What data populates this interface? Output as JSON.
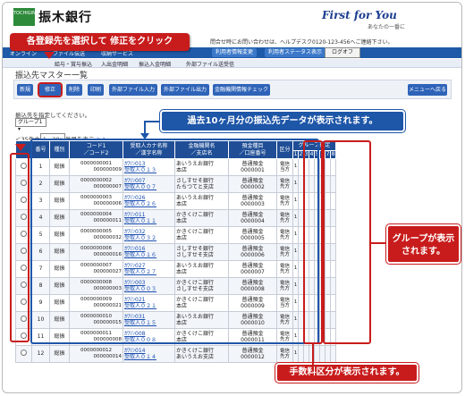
{
  "header": {
    "logo_text": "TOCHIGIN",
    "bank_name": "振木銀行",
    "slogan": "First for You",
    "tagline": "あなたの一番に",
    "contact": "問合せ時にお問い合わせは、ヘルプデスク0120-123-456へご連絡下さい。"
  },
  "nav": {
    "items": [
      "オンライン",
      "ファイル伝送",
      "収納サービス"
    ],
    "pills": [
      "利用者情報変更",
      "利用者ステータス表示"
    ],
    "logout": "ログオフ"
  },
  "sub_nav": [
    "給与・賞与振込",
    "入出金明細",
    "振込入金明細",
    "外部ファイル送受信"
  ],
  "page_title": "振込先マスター一覧",
  "toolbar": {
    "buttons": [
      "新規",
      "修正",
      "削除",
      "印刷",
      "外部ファイル入力",
      "外部ファイル出力",
      "金融機関情報チェック"
    ],
    "menu_back": "メニューへ戻る"
  },
  "instruction": "振込先を指定してください。",
  "group_select": "グループ1",
  "pager": {
    "prefix": "＜35件中",
    "select_value": "1〜20",
    "suffix": "件目を表示",
    "next": "＞＞"
  },
  "table": {
    "headers": {
      "num": "番号",
      "kind": "種別",
      "code": "コード1\n／コード2",
      "kana": "受取人カナ名称\n／漢字名称",
      "bank": "金融機関名\n／支店名",
      "account": "預金種目\n／口座番号",
      "fee": "区分",
      "group": "グループ指定",
      "group_cols": [
        "1",
        "2",
        "3",
        "4",
        "5",
        "6",
        "7",
        "8"
      ]
    },
    "rows": [
      {
        "num": "1",
        "kind": "総振",
        "code1": "0000000001",
        "code2": "000000009",
        "kana": "ｶﾜﾘﾝ013",
        "kanji": "受取人０１３",
        "bank": "あいうえお銀行",
        "branch": "本店",
        "acct_type": "普通預金",
        "acct_no": "0000001",
        "fee": "電信当方",
        "groups": [
          "1",
          "",
          "",
          "",
          "",
          "",
          "",
          ""
        ]
      },
      {
        "num": "2",
        "kind": "総振",
        "code1": "0000000002",
        "code2": "000000007",
        "kana": "ｶﾜﾘﾝ007",
        "kanji": "受取人００７",
        "bank": "さしすせそ銀行",
        "branch": "たちつてと支店",
        "acct_type": "普通預金",
        "acct_no": "0000002",
        "fee": "電信先方",
        "groups": [
          "1",
          "",
          "",
          "",
          "",
          "",
          "",
          ""
        ]
      },
      {
        "num": "3",
        "kind": "総振",
        "code1": "0000000003",
        "code2": "000000006",
        "kana": "ｶﾜﾘﾝ026",
        "kanji": "受取人０２６",
        "bank": "あいうえお銀行",
        "branch": "本店",
        "acct_type": "普通預金",
        "acct_no": "0000003",
        "fee": "電信先方",
        "groups": [
          "1",
          "",
          "",
          "",
          "",
          "",
          "",
          ""
        ]
      },
      {
        "num": "4",
        "kind": "総振",
        "code1": "0000000004",
        "code2": "000000011",
        "kana": "ｶﾜﾘﾝ011",
        "kanji": "受取人０１１",
        "bank": "かきくけこ銀行",
        "branch": "本店",
        "acct_type": "普通預金",
        "acct_no": "0000004",
        "fee": "電信先方",
        "groups": [
          "1",
          "",
          "",
          "",
          "",
          "",
          "",
          ""
        ]
      },
      {
        "num": "5",
        "kind": "総振",
        "code1": "0000000005",
        "code2": "000000032",
        "kana": "ｶﾜﾘﾝ032",
        "kanji": "受取人０３２",
        "bank": "かきくけこ銀行",
        "branch": "本店",
        "acct_type": "普通預金",
        "acct_no": "0000005",
        "fee": "電信先方",
        "groups": [
          "1",
          "",
          "",
          "",
          "",
          "",
          "",
          ""
        ]
      },
      {
        "num": "6",
        "kind": "総振",
        "code1": "0000000006",
        "code2": "000000016",
        "kana": "ｶﾜﾘﾝ016",
        "kanji": "受取人０１６",
        "bank": "さしすせそ銀行",
        "branch": "さしすせそ支店",
        "acct_type": "普通預金",
        "acct_no": "0000006",
        "fee": "電信先方",
        "groups": [
          "1",
          "",
          "",
          "",
          "",
          "",
          "",
          ""
        ]
      },
      {
        "num": "7",
        "kind": "総振",
        "code1": "0000000007",
        "code2": "000000027",
        "kana": "ｶﾜﾘﾝ027",
        "kanji": "受取人０２７",
        "bank": "あいうえお銀行",
        "branch": "本店",
        "acct_type": "普通預金",
        "acct_no": "0000007",
        "fee": "電信先方",
        "groups": [
          "1",
          "",
          "",
          "",
          "",
          "",
          "",
          ""
        ]
      },
      {
        "num": "8",
        "kind": "総振",
        "code1": "0000000008",
        "code2": "000000003",
        "kana": "ｶﾜﾘﾝ003",
        "kanji": "受取人００３",
        "bank": "かきくけこ銀行",
        "branch": "さしすせそ支店",
        "acct_type": "普通預金",
        "acct_no": "0000008",
        "fee": "電信先方",
        "groups": [
          "1",
          "",
          "",
          "",
          "",
          "",
          "",
          ""
        ]
      },
      {
        "num": "9",
        "kind": "総振",
        "code1": "0000000009",
        "code2": "000000021",
        "kana": "ｶﾜﾘﾝ021",
        "kanji": "受取人０２１",
        "bank": "かきくけこ銀行",
        "branch": "本店",
        "acct_type": "普通預金",
        "acct_no": "0000009",
        "fee": "電信当方",
        "groups": [
          "1",
          "",
          "",
          "",
          "",
          "",
          "",
          ""
        ]
      },
      {
        "num": "10",
        "kind": "総振",
        "code1": "0000000010",
        "code2": "000000015",
        "kana": "ｶﾜﾘﾝ031",
        "kanji": "受取人０１５",
        "bank": "あいうえお銀行",
        "branch": "本店",
        "acct_type": "普通預金",
        "acct_no": "0000010",
        "fee": "電信先方",
        "groups": [
          "1",
          "",
          "",
          "",
          "",
          "",
          "",
          ""
        ]
      },
      {
        "num": "11",
        "kind": "総振",
        "code1": "0000000011",
        "code2": "000000008",
        "kana": "ｶﾜﾘﾝ008",
        "kanji": "受取人００８",
        "bank": "かきくけこ銀行",
        "branch": "本店",
        "acct_type": "普通預金",
        "acct_no": "0000011",
        "fee": "電信先方",
        "groups": [
          "1",
          "",
          "",
          "",
          "",
          "",
          "",
          ""
        ]
      },
      {
        "num": "12",
        "kind": "総振",
        "code1": "0000000012",
        "code2": "000000014",
        "kana": "ｶﾜﾘﾝ014",
        "kanji": "受取人０１４",
        "bank": "かきくけこ銀行",
        "branch": "あいうえお支店",
        "acct_type": "普通預金",
        "acct_no": "0000012",
        "fee": "電信先方",
        "groups": [
          "1",
          "",
          "",
          "",
          "",
          "",
          "",
          ""
        ]
      }
    ]
  },
  "callouts": {
    "select_edit": "各登録先を選択して 修正をクリック",
    "history": "過去10ヶ月分の振込先データが表示されます。",
    "group": "グループが表示されます。",
    "fee": "手数料区分が表示されます。"
  },
  "colors": {
    "accent_red": "#c81c1c",
    "accent_blue": "#1e56a8",
    "table_header": "#1f4e96",
    "brand_green": "#2d8a3a"
  }
}
